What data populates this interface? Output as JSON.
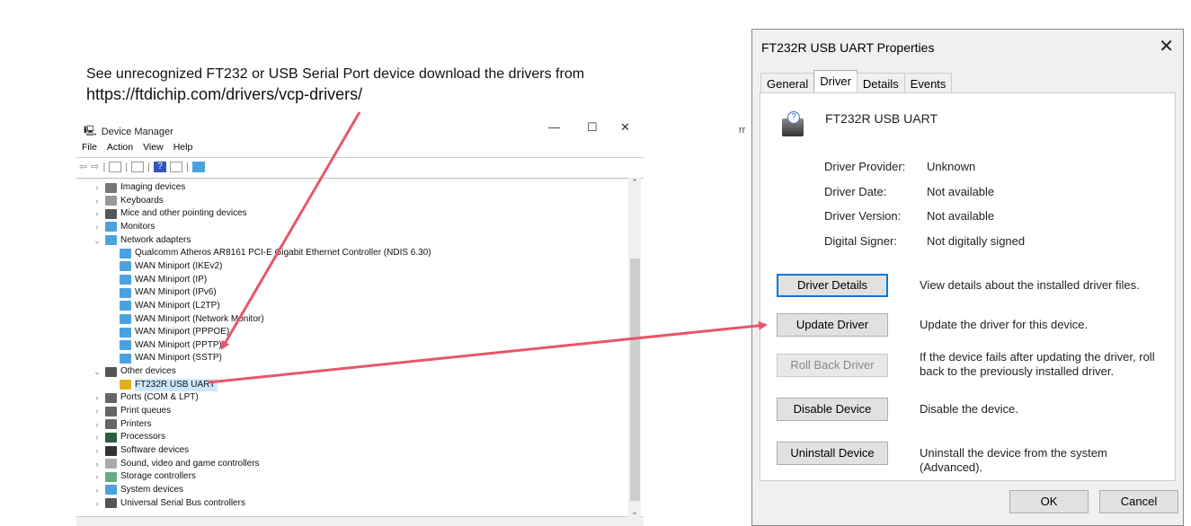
{
  "note": {
    "line1": "See unrecognized FT232 or USB Serial Port device download the drivers from",
    "line2": "https://ftdichip.com/drivers/vcp-drivers/"
  },
  "fragment": "rr",
  "device_manager": {
    "title": "Device Manager",
    "menu": [
      "File",
      "Action",
      "View",
      "Help"
    ],
    "tree": [
      {
        "label": "Imaging devices",
        "level": 0,
        "expanded": false,
        "icon": "camera-icon"
      },
      {
        "label": "Keyboards",
        "level": 0,
        "expanded": false,
        "icon": "keyboard-icon"
      },
      {
        "label": "Mice and other pointing devices",
        "level": 0,
        "expanded": false,
        "icon": "mouse-icon"
      },
      {
        "label": "Monitors",
        "level": 0,
        "expanded": false,
        "icon": "monitor-icon"
      },
      {
        "label": "Network adapters",
        "level": 0,
        "expanded": true,
        "icon": "network-icon"
      },
      {
        "label": "Qualcomm Atheros AR8161 PCI-E Gigabit Ethernet Controller (NDIS 6.30)",
        "level": 1,
        "icon": "network-icon"
      },
      {
        "label": "WAN Miniport (IKEv2)",
        "level": 1,
        "icon": "network-icon"
      },
      {
        "label": "WAN Miniport (IP)",
        "level": 1,
        "icon": "network-icon"
      },
      {
        "label": "WAN Miniport (IPv6)",
        "level": 1,
        "icon": "network-icon"
      },
      {
        "label": "WAN Miniport (L2TP)",
        "level": 1,
        "icon": "network-icon"
      },
      {
        "label": "WAN Miniport (Network Monitor)",
        "level": 1,
        "icon": "network-icon"
      },
      {
        "label": "WAN Miniport (PPPOE)",
        "level": 1,
        "icon": "network-icon"
      },
      {
        "label": "WAN Miniport (PPTP)",
        "level": 1,
        "icon": "network-icon"
      },
      {
        "label": "WAN Miniport (SSTP)",
        "level": 1,
        "icon": "network-icon"
      },
      {
        "label": "Other devices",
        "level": 0,
        "expanded": true,
        "icon": "unknown-device-icon"
      },
      {
        "label": "FT232R USB UART",
        "level": 1,
        "icon": "warning-device-icon",
        "selected": true
      },
      {
        "label": "Ports (COM & LPT)",
        "level": 0,
        "expanded": false,
        "icon": "port-icon"
      },
      {
        "label": "Print queues",
        "level": 0,
        "expanded": false,
        "icon": "printer-icon"
      },
      {
        "label": "Printers",
        "level": 0,
        "expanded": false,
        "icon": "printer-icon"
      },
      {
        "label": "Processors",
        "level": 0,
        "expanded": false,
        "icon": "chip-icon"
      },
      {
        "label": "Software devices",
        "level": 0,
        "expanded": false,
        "icon": "software-icon"
      },
      {
        "label": "Sound, video and game controllers",
        "level": 0,
        "expanded": false,
        "icon": "speaker-icon"
      },
      {
        "label": "Storage controllers",
        "level": 0,
        "expanded": false,
        "icon": "storage-icon"
      },
      {
        "label": "System devices",
        "level": 0,
        "expanded": false,
        "icon": "system-icon"
      },
      {
        "label": "Universal Serial Bus controllers",
        "level": 0,
        "expanded": false,
        "icon": "usb-icon"
      }
    ]
  },
  "dialog": {
    "title": "FT232R USB UART Properties",
    "tabs": [
      "General",
      "Driver",
      "Details",
      "Events"
    ],
    "active_tab": "Driver",
    "device_name": "FT232R USB UART",
    "props": [
      {
        "label": "Driver Provider:",
        "value": "Unknown"
      },
      {
        "label": "Driver Date:",
        "value": "Not available"
      },
      {
        "label": "Driver Version:",
        "value": "Not available"
      },
      {
        "label": "Digital Signer:",
        "value": "Not digitally signed"
      }
    ],
    "actions": [
      {
        "button": "Driver Details",
        "desc": "View details about the installed driver files."
      },
      {
        "button": "Update Driver",
        "desc": "Update the driver for this device."
      },
      {
        "button": "Roll Back Driver",
        "desc": "If the device fails after updating the driver, roll back to the previously installed driver.",
        "disabled": true
      },
      {
        "button": "Disable Device",
        "desc": "Disable the device."
      },
      {
        "button": "Uninstall Device",
        "desc": "Uninstall the device from the system (Advanced)."
      }
    ],
    "ok": "OK",
    "cancel": "Cancel"
  },
  "colors": {
    "arrow": "#e8566a",
    "selection": "#cce8ff",
    "focus": "#0078d7"
  }
}
